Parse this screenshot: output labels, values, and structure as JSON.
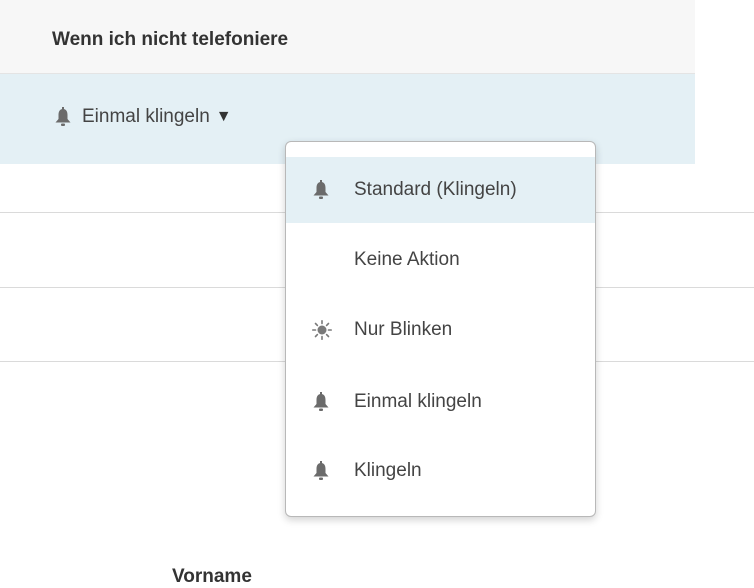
{
  "section": {
    "title": "Wenn ich nicht telefoniere"
  },
  "current": {
    "label": "Einmal klingeln",
    "icon": "bell-icon"
  },
  "menu": {
    "items": [
      {
        "label": "Standard (Klingeln)",
        "icon": "bell-icon",
        "active": true
      },
      {
        "label": "Keine Aktion",
        "icon": "",
        "active": false
      },
      {
        "label": "Nur Blinken",
        "icon": "blink-icon",
        "active": false
      },
      {
        "label": "Einmal klingeln",
        "icon": "bell-icon",
        "active": false
      },
      {
        "label": "Klingeln",
        "icon": "bell-icon",
        "active": false
      }
    ]
  },
  "form": {
    "vorname_label": "Vorname"
  },
  "colors": {
    "highlight": "#e4f0f5",
    "header_bg": "#f7f7f7",
    "text": "#444444",
    "border": "#b8b8b8"
  }
}
